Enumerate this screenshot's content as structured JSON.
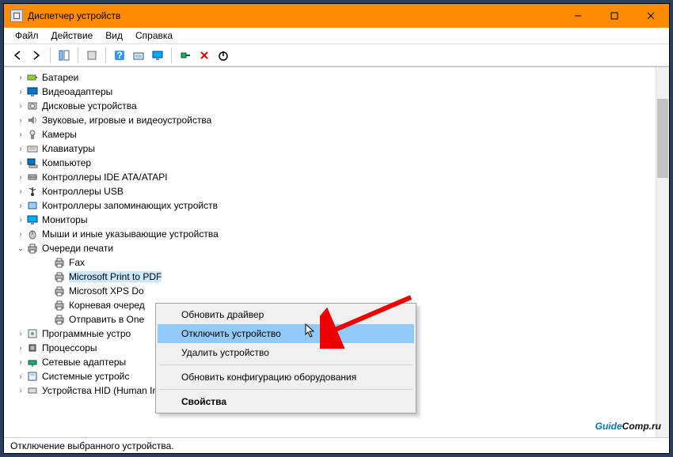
{
  "window": {
    "title": "Диспетчер устройств"
  },
  "menubar": [
    "Файл",
    "Действие",
    "Вид",
    "Справка"
  ],
  "toolbar_icons": [
    "back-icon",
    "forward-icon",
    "show-hide-icon",
    "properties-icon",
    "help-icon",
    "scan-icon",
    "monitor-icon",
    "plug-icon",
    "delete-icon",
    "enable-icon"
  ],
  "tree": [
    {
      "label": "Батареи",
      "icon": "battery"
    },
    {
      "label": "Видеоадаптеры",
      "icon": "display"
    },
    {
      "label": "Дисковые устройства",
      "icon": "disk"
    },
    {
      "label": "Звуковые, игровые и видеоустройства",
      "icon": "sound"
    },
    {
      "label": "Камеры",
      "icon": "camera"
    },
    {
      "label": "Клавиатуры",
      "icon": "keyboard"
    },
    {
      "label": "Компьютер",
      "icon": "computer"
    },
    {
      "label": "Контроллеры IDE ATA/ATAPI",
      "icon": "ide"
    },
    {
      "label": "Контроллеры USB",
      "icon": "usb"
    },
    {
      "label": "Контроллеры запоминающих устройств",
      "icon": "storage"
    },
    {
      "label": "Мониторы",
      "icon": "monitor"
    },
    {
      "label": "Мыши и иные указывающие устройства",
      "icon": "mouse"
    },
    {
      "label": "Очереди печати",
      "icon": "printer",
      "expanded": true,
      "children": [
        {
          "label": "Fax",
          "icon": "printer"
        },
        {
          "label": "Microsoft Print to PDF",
          "icon": "printer",
          "selected": true
        },
        {
          "label": "Microsoft XPS Do",
          "icon": "printer"
        },
        {
          "label": "Корневая очеред",
          "icon": "printer"
        },
        {
          "label": "Отправить в One",
          "icon": "printer"
        }
      ]
    },
    {
      "label": "Программные устро",
      "icon": "software"
    },
    {
      "label": "Процессоры",
      "icon": "cpu"
    },
    {
      "label": "Сетевые адаптеры",
      "icon": "network"
    },
    {
      "label": "Системные устройс",
      "icon": "system"
    },
    {
      "label": "Устройства HID (Human Interface Devices)",
      "icon": "hid"
    }
  ],
  "context_menu": {
    "items": [
      {
        "label": "Обновить драйвер",
        "hl": false
      },
      {
        "label": "Отключить устройство",
        "hl": true
      },
      {
        "label": "Удалить устройство",
        "hl": false
      },
      {
        "sep": true
      },
      {
        "label": "Обновить конфигурацию оборудования",
        "hl": false
      },
      {
        "sep": true
      },
      {
        "label": "Свойства",
        "bold": true
      }
    ]
  },
  "statusbar": "Отключение выбранного устройства.",
  "watermark": {
    "g": "Guide",
    "rest": "Comp.ru"
  }
}
